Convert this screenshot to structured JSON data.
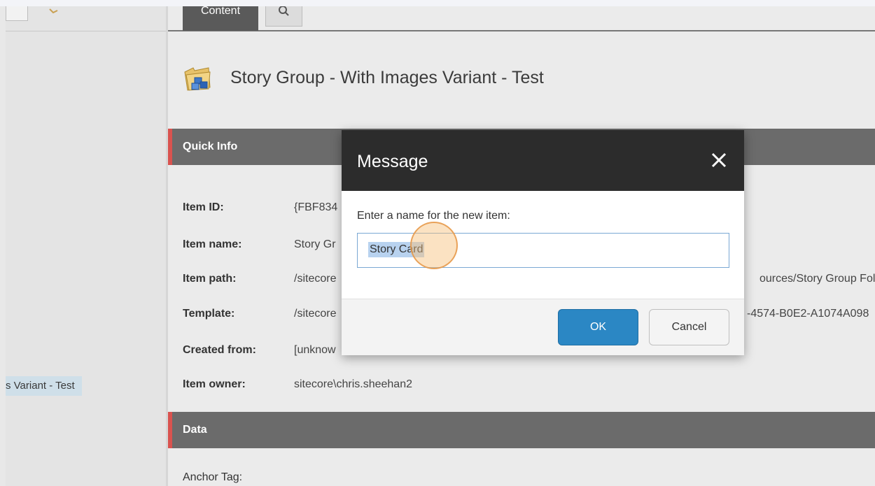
{
  "tree": {
    "selected_item": "s Variant - Test"
  },
  "tabs": {
    "content_label": "Content"
  },
  "header": {
    "title": "Story Group - With Images Variant - Test"
  },
  "quick_info": {
    "section_label": "Quick Info",
    "fields": [
      {
        "label": "Item ID:",
        "value": "{FBF834",
        "overflow": ""
      },
      {
        "label": "Item name:",
        "value": "Story Gr",
        "overflow": ""
      },
      {
        "label": "Item path:",
        "value": "/sitecore",
        "overflow": "ources/Story Group Fol"
      },
      {
        "label": "Template:",
        "value": "/sitecore",
        "overflow": "-4574-B0E2-A1074A098"
      },
      {
        "label": "Created from:",
        "value": "[unknow",
        "overflow": ""
      },
      {
        "label": "Item owner:",
        "value": "sitecore\\chris.sheehan2",
        "overflow": ""
      }
    ]
  },
  "data_section": {
    "section_label": "Data",
    "anchor_label": "Anchor Tag:"
  },
  "modal": {
    "title": "Message",
    "prompt": "Enter a name for the new item:",
    "input_value": "Story Card",
    "ok_label": "OK",
    "cancel_label": "Cancel"
  },
  "icons": {
    "close": "close-icon",
    "search": "search-icon",
    "folder": "folder-icon"
  },
  "colors": {
    "accent_red": "#d9534f",
    "ok_blue": "#2b87c4",
    "modal_header": "#2c2c2c",
    "selection": "#cfdfe9"
  }
}
